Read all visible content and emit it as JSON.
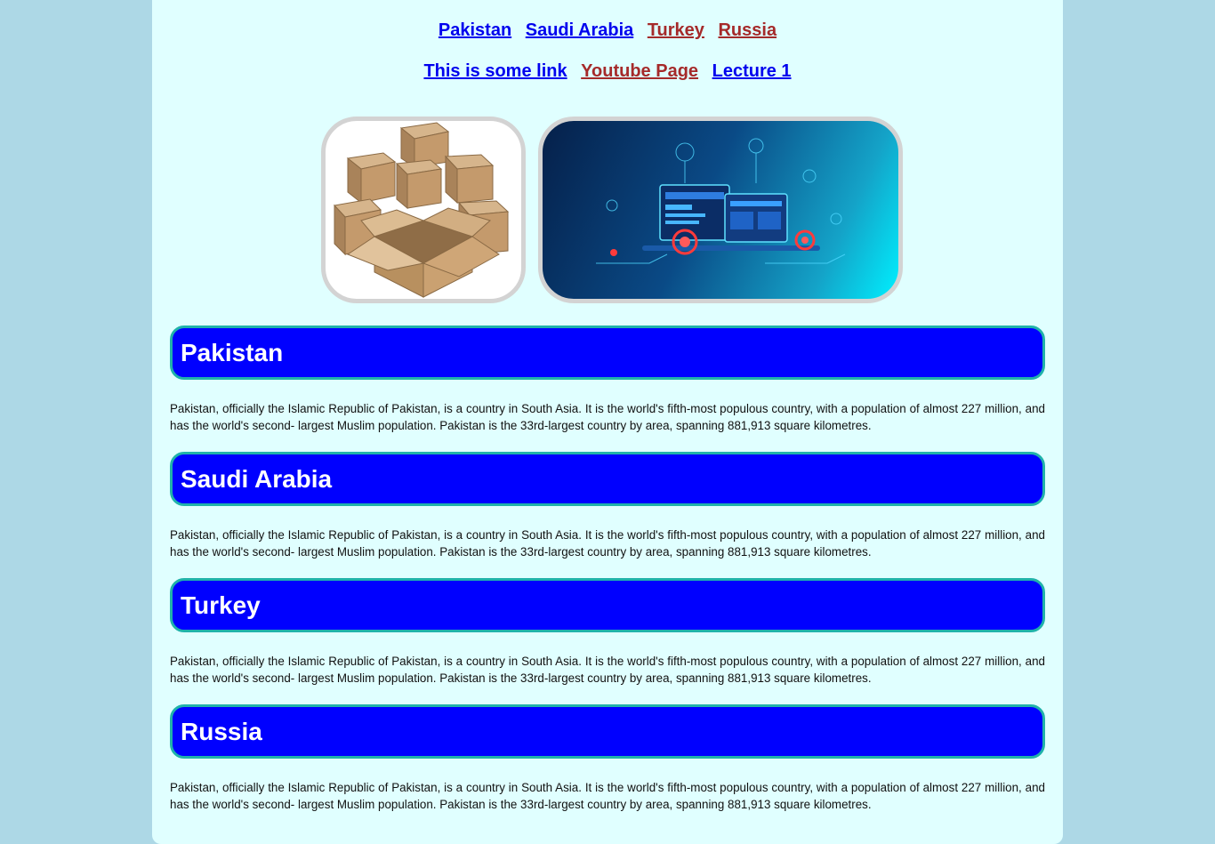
{
  "nav": {
    "row1": [
      {
        "label": "Pakistan",
        "state": "unvisited"
      },
      {
        "label": "Saudi Arabia",
        "state": "unvisited"
      },
      {
        "label": "Turkey",
        "state": "visited"
      },
      {
        "label": "Russia",
        "state": "visited"
      }
    ],
    "row2": [
      {
        "label": "This is some link",
        "state": "unvisited"
      },
      {
        "label": "Youtube Page",
        "state": "visited"
      },
      {
        "label": "Lecture 1",
        "state": "unvisited"
      }
    ]
  },
  "images": [
    {
      "name": "cardboard-boxes-image"
    },
    {
      "name": "web-development-illustration-image"
    }
  ],
  "sections": [
    {
      "heading": "Pakistan",
      "text": "Pakistan, officially the Islamic Republic of Pakistan, is a country in South Asia. It is the world's fifth-most populous country, with a population of almost 227 million, and has the world's second- largest Muslim population. Pakistan is the 33rd-largest country by area, spanning 881,913 square kilometres."
    },
    {
      "heading": "Saudi Arabia",
      "text": "Pakistan, officially the Islamic Republic of Pakistan, is a country in South Asia. It is the world's fifth-most populous country, with a population of almost 227 million, and has the world's second- largest Muslim population. Pakistan is the 33rd-largest country by area, spanning 881,913 square kilometres."
    },
    {
      "heading": "Turkey",
      "text": "Pakistan, officially the Islamic Republic of Pakistan, is a country in South Asia. It is the world's fifth-most populous country, with a population of almost 227 million, and has the world's second- largest Muslim population. Pakistan is the 33rd-largest country by area, spanning 881,913 square kilometres."
    },
    {
      "heading": "Russia",
      "text": "Pakistan, officially the Islamic Republic of Pakistan, is a country in South Asia. It is the world's fifth-most populous country, with a population of almost 227 million, and has the world's second- largest Muslim population. Pakistan is the 33rd-largest country by area, spanning 881,913 square kilometres."
    }
  ],
  "colors": {
    "page_background": "#add8e6",
    "content_background": "#e0ffff",
    "heading_background": "#0000ff",
    "heading_border": "#20b2aa",
    "link_unvisited": "#0000ee",
    "link_visited": "#a52a2a"
  }
}
